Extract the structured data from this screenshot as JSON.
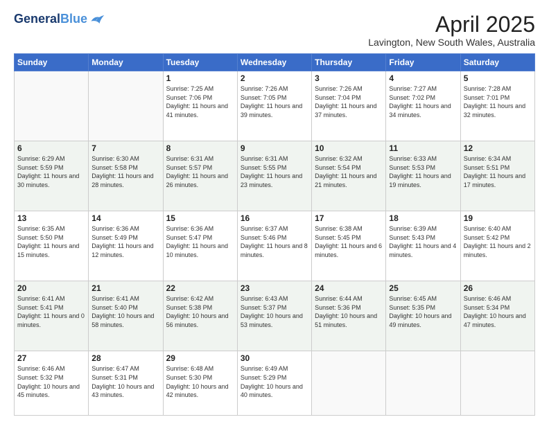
{
  "header": {
    "logo_line1": "General",
    "logo_line2": "Blue",
    "title": "April 2025",
    "subtitle": "Lavington, New South Wales, Australia"
  },
  "days_of_week": [
    "Sunday",
    "Monday",
    "Tuesday",
    "Wednesday",
    "Thursday",
    "Friday",
    "Saturday"
  ],
  "weeks": [
    [
      {
        "day": "",
        "info": ""
      },
      {
        "day": "",
        "info": ""
      },
      {
        "day": "1",
        "info": "Sunrise: 7:25 AM\nSunset: 7:06 PM\nDaylight: 11 hours and 41 minutes."
      },
      {
        "day": "2",
        "info": "Sunrise: 7:26 AM\nSunset: 7:05 PM\nDaylight: 11 hours and 39 minutes."
      },
      {
        "day": "3",
        "info": "Sunrise: 7:26 AM\nSunset: 7:04 PM\nDaylight: 11 hours and 37 minutes."
      },
      {
        "day": "4",
        "info": "Sunrise: 7:27 AM\nSunset: 7:02 PM\nDaylight: 11 hours and 34 minutes."
      },
      {
        "day": "5",
        "info": "Sunrise: 7:28 AM\nSunset: 7:01 PM\nDaylight: 11 hours and 32 minutes."
      }
    ],
    [
      {
        "day": "6",
        "info": "Sunrise: 6:29 AM\nSunset: 5:59 PM\nDaylight: 11 hours and 30 minutes."
      },
      {
        "day": "7",
        "info": "Sunrise: 6:30 AM\nSunset: 5:58 PM\nDaylight: 11 hours and 28 minutes."
      },
      {
        "day": "8",
        "info": "Sunrise: 6:31 AM\nSunset: 5:57 PM\nDaylight: 11 hours and 26 minutes."
      },
      {
        "day": "9",
        "info": "Sunrise: 6:31 AM\nSunset: 5:55 PM\nDaylight: 11 hours and 23 minutes."
      },
      {
        "day": "10",
        "info": "Sunrise: 6:32 AM\nSunset: 5:54 PM\nDaylight: 11 hours and 21 minutes."
      },
      {
        "day": "11",
        "info": "Sunrise: 6:33 AM\nSunset: 5:53 PM\nDaylight: 11 hours and 19 minutes."
      },
      {
        "day": "12",
        "info": "Sunrise: 6:34 AM\nSunset: 5:51 PM\nDaylight: 11 hours and 17 minutes."
      }
    ],
    [
      {
        "day": "13",
        "info": "Sunrise: 6:35 AM\nSunset: 5:50 PM\nDaylight: 11 hours and 15 minutes."
      },
      {
        "day": "14",
        "info": "Sunrise: 6:36 AM\nSunset: 5:49 PM\nDaylight: 11 hours and 12 minutes."
      },
      {
        "day": "15",
        "info": "Sunrise: 6:36 AM\nSunset: 5:47 PM\nDaylight: 11 hours and 10 minutes."
      },
      {
        "day": "16",
        "info": "Sunrise: 6:37 AM\nSunset: 5:46 PM\nDaylight: 11 hours and 8 minutes."
      },
      {
        "day": "17",
        "info": "Sunrise: 6:38 AM\nSunset: 5:45 PM\nDaylight: 11 hours and 6 minutes."
      },
      {
        "day": "18",
        "info": "Sunrise: 6:39 AM\nSunset: 5:43 PM\nDaylight: 11 hours and 4 minutes."
      },
      {
        "day": "19",
        "info": "Sunrise: 6:40 AM\nSunset: 5:42 PM\nDaylight: 11 hours and 2 minutes."
      }
    ],
    [
      {
        "day": "20",
        "info": "Sunrise: 6:41 AM\nSunset: 5:41 PM\nDaylight: 11 hours and 0 minutes."
      },
      {
        "day": "21",
        "info": "Sunrise: 6:41 AM\nSunset: 5:40 PM\nDaylight: 10 hours and 58 minutes."
      },
      {
        "day": "22",
        "info": "Sunrise: 6:42 AM\nSunset: 5:38 PM\nDaylight: 10 hours and 56 minutes."
      },
      {
        "day": "23",
        "info": "Sunrise: 6:43 AM\nSunset: 5:37 PM\nDaylight: 10 hours and 53 minutes."
      },
      {
        "day": "24",
        "info": "Sunrise: 6:44 AM\nSunset: 5:36 PM\nDaylight: 10 hours and 51 minutes."
      },
      {
        "day": "25",
        "info": "Sunrise: 6:45 AM\nSunset: 5:35 PM\nDaylight: 10 hours and 49 minutes."
      },
      {
        "day": "26",
        "info": "Sunrise: 6:46 AM\nSunset: 5:34 PM\nDaylight: 10 hours and 47 minutes."
      }
    ],
    [
      {
        "day": "27",
        "info": "Sunrise: 6:46 AM\nSunset: 5:32 PM\nDaylight: 10 hours and 45 minutes."
      },
      {
        "day": "28",
        "info": "Sunrise: 6:47 AM\nSunset: 5:31 PM\nDaylight: 10 hours and 43 minutes."
      },
      {
        "day": "29",
        "info": "Sunrise: 6:48 AM\nSunset: 5:30 PM\nDaylight: 10 hours and 42 minutes."
      },
      {
        "day": "30",
        "info": "Sunrise: 6:49 AM\nSunset: 5:29 PM\nDaylight: 10 hours and 40 minutes."
      },
      {
        "day": "",
        "info": ""
      },
      {
        "day": "",
        "info": ""
      },
      {
        "day": "",
        "info": ""
      }
    ]
  ]
}
